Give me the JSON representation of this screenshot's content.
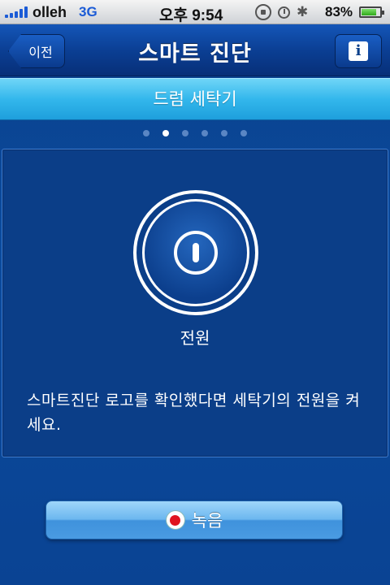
{
  "status_bar": {
    "carrier": "olleh",
    "network": "3G",
    "time": "오후 9:54",
    "battery": "83%",
    "battery_level": 0.83,
    "icons": [
      "signal-icon",
      "rotation-lock-icon",
      "alarm-icon",
      "bluetooth-icon",
      "battery-icon"
    ]
  },
  "navbar": {
    "back_label": "이전",
    "title": "스마트 진단",
    "info_label": "i"
  },
  "subheader": {
    "title": "드럼 세탁기"
  },
  "pager": {
    "count": 6,
    "active_index": 1
  },
  "panel": {
    "power_label": "전원",
    "instruction": "스마트진단 로고를 확인했다면 세탁기의 전원을 켜세요."
  },
  "record_button": {
    "label": "녹음"
  },
  "colors": {
    "background": "#0b4a9c",
    "subheader": "#33b7ec",
    "record_dot": "#e0141e"
  }
}
